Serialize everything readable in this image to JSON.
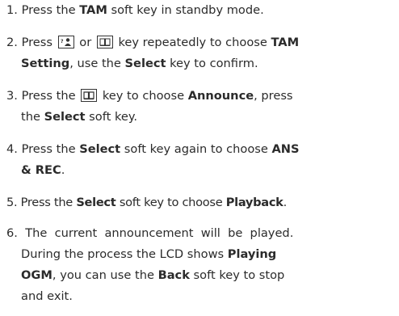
{
  "steps": [
    {
      "num": "1.",
      "parts": [
        {
          "t": "Press the ",
          "b": false
        },
        {
          "t": "TAM",
          "b": true
        },
        {
          "t": " soft key in standby mode.",
          "b": false
        }
      ]
    },
    {
      "num": "2.",
      "line1_a": "Press",
      "line1_b": "or",
      "line1_c": "key repeatedly to choose",
      "line1_d": "TAM",
      "line2_a": "Setting",
      "line2_b": ", use the",
      "line2_c": "Select",
      "line2_d": "key to confirm."
    },
    {
      "num": "3.",
      "line1_a": "Press the",
      "line1_b": "key to choose",
      "line1_c": "Announce",
      "line1_d": ", press",
      "line2_a": "the",
      "line2_b": "Select",
      "line2_c": "soft key."
    },
    {
      "num": "4.",
      "line1_a": "Press the",
      "line1_b": "Select",
      "line1_c": "soft key again to choose",
      "line1_d": "ANS",
      "line2_a": "& REC",
      "line2_b": "."
    },
    {
      "num": "5.",
      "a": "Press the",
      "b": "Select",
      "c": "soft key to choose",
      "d": "Playback",
      "e": "."
    },
    {
      "num": "6.",
      "line1": "The current announcement will be played.",
      "line2_a": "During the process the LCD shows",
      "line2_b": "Playing",
      "line3_a": "OGM",
      "line3_b": ", you can use the",
      "line3_c": "Back",
      "line3_d": "soft key to stop",
      "line4": "and exit."
    }
  ],
  "icons": [
    "contact-key-icon",
    "phonebook-key-icon",
    "phonebook-key-icon"
  ]
}
